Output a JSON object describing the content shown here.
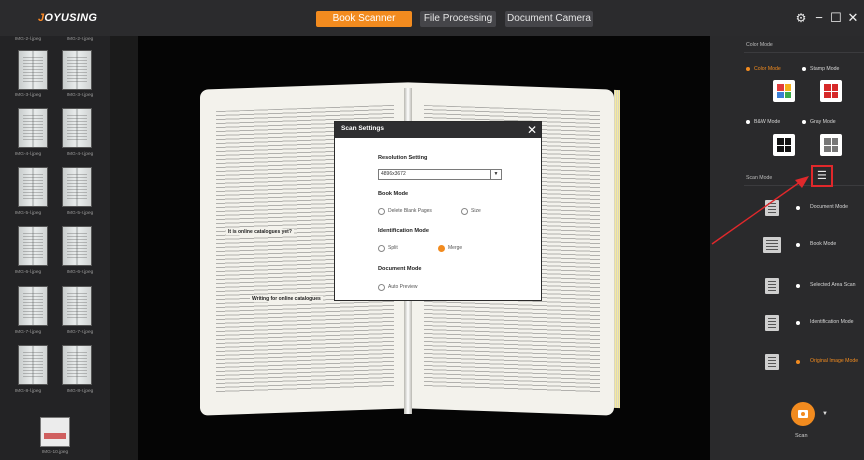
{
  "app": {
    "logo_prefix": "J",
    "logo_rest": "OYUSING"
  },
  "tabs": [
    {
      "label": "Book Scanner",
      "active": true
    },
    {
      "label": "File Processing",
      "active": false
    },
    {
      "label": "Document Camera",
      "active": false
    }
  ],
  "window_controls": {
    "gear_icon": "gear-icon",
    "minimize": "−",
    "maximize": "☐",
    "close": "✕"
  },
  "thumbnails": [
    {
      "left": "IMG-2-l.jpeg",
      "right": "IMG-2-r.jpeg"
    },
    {
      "left": "IMG-3-l.jpeg",
      "right": "IMG-3-r.jpeg"
    },
    {
      "left": "IMG-4-l.jpeg",
      "right": "IMG-4-r.jpeg"
    },
    {
      "left": "IMG-5-l.jpeg",
      "right": "IMG-5-r.jpeg"
    },
    {
      "left": "IMG-6-l.jpeg",
      "right": "IMG-6-r.jpeg"
    },
    {
      "left": "IMG-7-l.jpeg",
      "right": "IMG-7-r.jpeg"
    },
    {
      "left": "IMG-8-l.jpeg",
      "right": "IMG-8-r.jpeg"
    }
  ],
  "thumbnail_single": "IMG-10.jpeg",
  "preview": {
    "heading_a": "It is online catalogues yet?",
    "heading_b": "Writing for online catalogues"
  },
  "scan_settings": {
    "title": "Scan Settings",
    "close": "✕",
    "resolution_label": "Resolution Setting",
    "resolution_value": "4896x3672",
    "book_mode_label": "Book Mode",
    "book_mode_options": [
      {
        "label": "Delete Blank Pages",
        "selected": false
      },
      {
        "label": "Size",
        "selected": false
      }
    ],
    "identification_label": "Identification Mode",
    "identification_options": [
      {
        "label": "Split",
        "selected": false
      },
      {
        "label": "Merge",
        "selected": true
      }
    ],
    "document_mode_label": "Document Mode",
    "document_mode_options": [
      {
        "label": "Auto Preview",
        "selected": false
      }
    ]
  },
  "right_panel": {
    "color_mode_title": "Color Mode",
    "color_modes": [
      {
        "label": "Color Mode",
        "selected": true
      },
      {
        "label": "Stamp Mode",
        "selected": false
      },
      {
        "label": "B&W Mode",
        "selected": false
      },
      {
        "label": "Gray Mode",
        "selected": false
      }
    ],
    "scan_mode_title": "Scan Mode",
    "scan_modes": [
      {
        "label": "Document Mode",
        "selected": false
      },
      {
        "label": "Book Mode",
        "selected": false
      },
      {
        "label": "Selected Area Scan",
        "selected": false
      },
      {
        "label": "Identification Mode",
        "selected": false
      },
      {
        "label": "Original Image Mode",
        "selected": true
      }
    ],
    "scan_label": "Scan"
  },
  "colors": {
    "accent": "#f28b1f",
    "highlight": "#e0282b"
  }
}
